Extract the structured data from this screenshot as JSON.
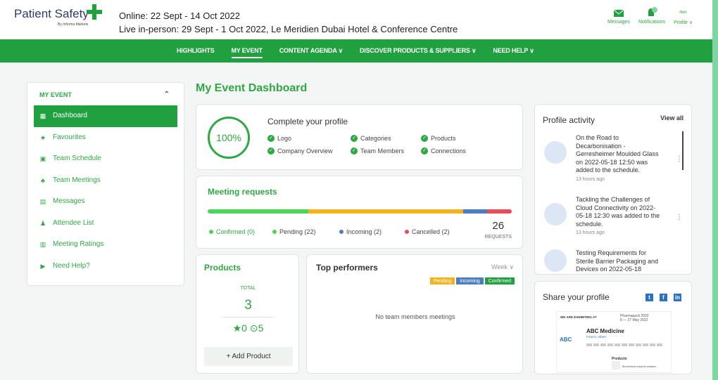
{
  "brand": {
    "name": "Patient Safety",
    "sub": "By Informa Markets"
  },
  "event": {
    "online": "Online: 22 Sept - 14 Oct 2022",
    "live": "Live in-person: 29 Sept - 1 Oct 2022, Le Meridien Dubai Hotel & Conference Centre"
  },
  "header_actions": {
    "messages": "Messages",
    "notifications": "Notifications",
    "profile": "Profile ∨",
    "profile_name": "Iftikh"
  },
  "nav": [
    "HIGHLIGHTS",
    "MY EVENT",
    "CONTENT AGENDA ∨",
    "DISCOVER PRODUCTS & SUPPLIERS ∨",
    "NEED HELP ∨"
  ],
  "sidebar": {
    "title": "MY EVENT",
    "items": [
      {
        "label": "Dashboard",
        "icon": "dashboard-icon",
        "glyph": "▦"
      },
      {
        "label": "Favourites",
        "icon": "star-icon",
        "glyph": "★"
      },
      {
        "label": "Team Schedule",
        "icon": "calendar-icon",
        "glyph": "▣"
      },
      {
        "label": "Team Meetings",
        "icon": "people-icon",
        "glyph": "♣"
      },
      {
        "label": "Messages",
        "icon": "message-icon",
        "glyph": "▤"
      },
      {
        "label": "Attendee List",
        "icon": "users-icon",
        "glyph": "♟"
      },
      {
        "label": "Meeting Ratings",
        "icon": "rating-icon",
        "glyph": "▥"
      },
      {
        "label": "Need Help?",
        "icon": "help-icon",
        "glyph": "▶"
      }
    ]
  },
  "main": {
    "title": "My Event Dashboard",
    "profile": {
      "percent": "100%",
      "title": "Complete your profile",
      "items": [
        "Logo",
        "Categories",
        "Products",
        "Company Overview",
        "Team Members",
        "Connections"
      ]
    },
    "meetings": {
      "title": "Meeting requests",
      "legend": [
        "Confirmed (0)",
        "Pending (22)",
        "Incoming (2)",
        "Cancelled (2)"
      ],
      "total": "26",
      "total_label": "REQUESTS",
      "values": {
        "confirmed": 0,
        "pending": 22,
        "incoming": 2,
        "cancelled": 2
      }
    },
    "products": {
      "title": "Products",
      "total_label": "TOTAL",
      "total": "3",
      "stats": "★0  ⊙5",
      "add": "+ Add Product"
    },
    "top": {
      "title": "Top performers",
      "week": "Week ∨",
      "tags": [
        "Pending",
        "Incoming",
        "Confirmed"
      ],
      "empty": "No team members meetings"
    }
  },
  "activity": {
    "title": "Profile activity",
    "view_all": "View all",
    "items": [
      {
        "text": "On the Road to Decarbonisation - Gerresheimer Moulded Glass on 2022-05-18 12:50 was added to the schedule.",
        "time": "13 hours ago"
      },
      {
        "text": "Tackling the Challenges of Cloud Connectivity on 2022-05-18 12:30 was added to the schedule.",
        "time": "13 hours ago"
      },
      {
        "text": "Testing Requirements for Sterile Barrier Packaging and Devices on 2022-05-18",
        "time": ""
      }
    ]
  },
  "share": {
    "title": "Share your profile",
    "preview": {
      "top": "WE ARE EXHIBITING AT",
      "event": "Pharmapack 2022",
      "event_dates": "8 — 27 May 2022",
      "abc": "ABC",
      "name": "ABC Medicine",
      "location": "France, Albert",
      "products": "Products",
      "product_name": "Biochemical enzymes analyzer"
    }
  },
  "colors": {
    "green": "#21a040",
    "pending": "#f2b31c",
    "incoming": "#4a7ec1",
    "cancelled": "#e84d5b",
    "confirmed_green": "#4fd45a"
  }
}
